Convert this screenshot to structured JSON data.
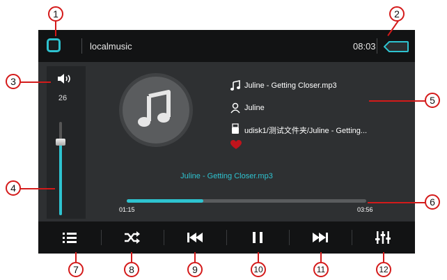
{
  "header": {
    "title": "localmusic",
    "clock": "08:03"
  },
  "volume": {
    "value": "26",
    "level_fraction": 0.78
  },
  "track": {
    "filename": "Juline - Getting Closer.mp3",
    "artist": "Juline",
    "path": "udisk1/测试文件夹/Juline - Getting...",
    "now_playing": "Juline - Getting Closer.mp3"
  },
  "progress": {
    "elapsed": "01:15",
    "total": "03:56",
    "fraction": 0.32
  },
  "controls": [
    {
      "icon": "list-icon"
    },
    {
      "icon": "shuffle-icon"
    },
    {
      "icon": "previous-track-icon"
    },
    {
      "icon": "pause-icon"
    },
    {
      "icon": "next-track-icon"
    },
    {
      "icon": "equalizer-icon"
    }
  ],
  "callouts": [
    "1",
    "2",
    "3",
    "4",
    "5",
    "6",
    "7",
    "8",
    "9",
    "10",
    "11",
    "12"
  ],
  "colors": {
    "accent": "#2ec3d0",
    "callout": "#d41a1a",
    "heart": "#c0141c"
  }
}
